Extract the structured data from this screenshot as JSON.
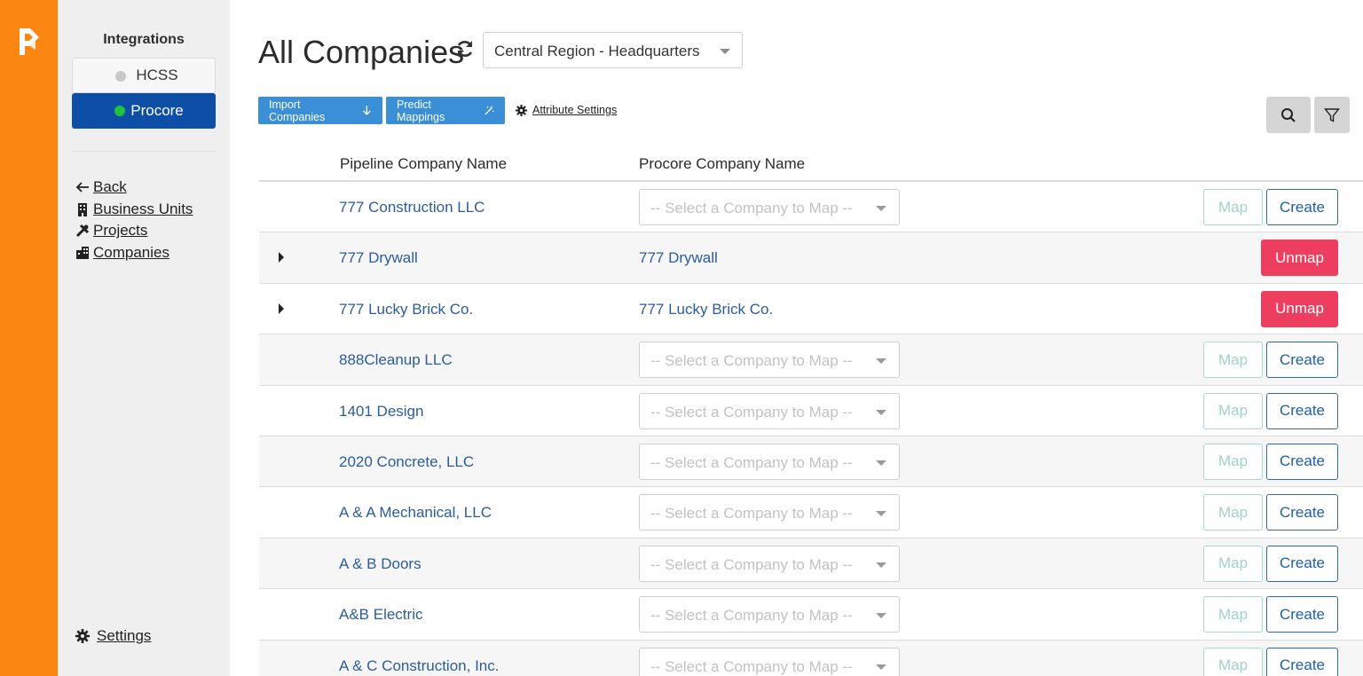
{
  "sidebar": {
    "integrations_title": "Integrations",
    "integrations": [
      {
        "label": "HCSS",
        "status": "inactive",
        "dot_color": "#c8c8c8"
      },
      {
        "label": "Procore",
        "status": "active",
        "dot_color": "#24c23c"
      }
    ],
    "nav": [
      {
        "label": "Back",
        "icon": "arrow-left-icon"
      },
      {
        "label": "Business Units",
        "icon": "building-icon"
      },
      {
        "label": "Projects",
        "icon": "tools-icon"
      },
      {
        "label": "Companies",
        "icon": "companies-icon"
      }
    ],
    "settings_label": "Settings"
  },
  "header": {
    "title": "All Companies",
    "region": "Central Region - Headquarters"
  },
  "toolbar": {
    "import_label": "Import Companies",
    "predict_label": "Predict Mappings",
    "attribute_settings_label": "Attribute Settings"
  },
  "table": {
    "col_pipeline": "Pipeline Company Name",
    "col_procore": "Procore Company Name",
    "select_placeholder": "-- Select a Company to Map --",
    "map_label": "Map",
    "create_label": "Create",
    "unmap_label": "Unmap",
    "rows": [
      {
        "pipeline": "777 Construction LLC",
        "mapped": null
      },
      {
        "pipeline": "777 Drywall",
        "mapped": "777 Drywall"
      },
      {
        "pipeline": "777 Lucky Brick Co.",
        "mapped": "777 Lucky Brick Co."
      },
      {
        "pipeline": "888Cleanup LLC",
        "mapped": null
      },
      {
        "pipeline": "1401 Design",
        "mapped": null
      },
      {
        "pipeline": "2020 Concrete, LLC",
        "mapped": null
      },
      {
        "pipeline": "A & A Mechanical, LLC",
        "mapped": null
      },
      {
        "pipeline": "A & B Doors",
        "mapped": null
      },
      {
        "pipeline": "A&B Electric",
        "mapped": null
      },
      {
        "pipeline": "A & C Construction, Inc.",
        "mapped": null
      }
    ]
  },
  "colors": {
    "rail": "#f98712",
    "active_integration": "#0d4fa6",
    "primary_button": "#3a8fd6",
    "unmap": "#ee3e5f",
    "link": "#2b5c9c"
  }
}
